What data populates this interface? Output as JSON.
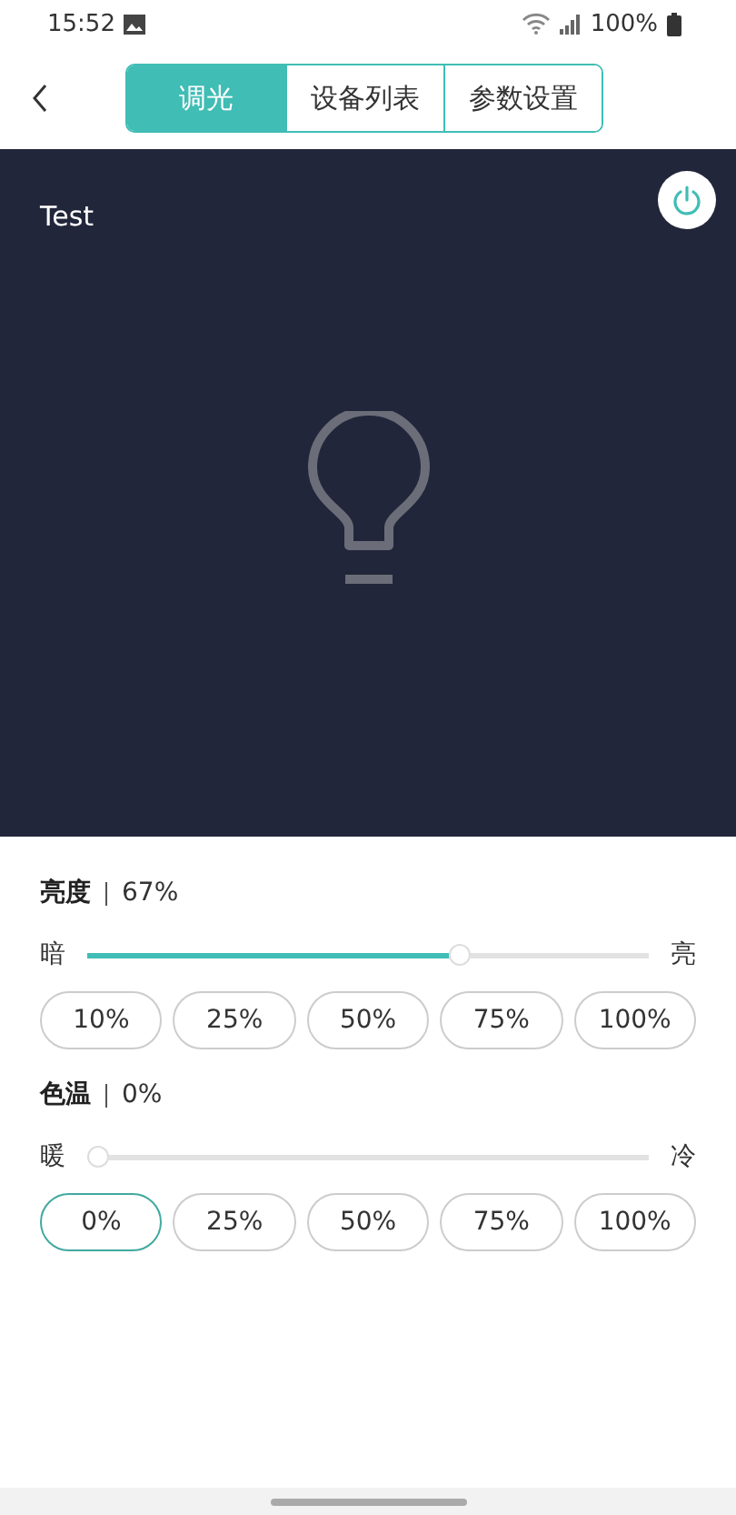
{
  "status_bar": {
    "time": "15:52",
    "battery": "100%"
  },
  "header": {
    "tabs": [
      {
        "label": "调光",
        "selected": true
      },
      {
        "label": "设备列表",
        "selected": false
      },
      {
        "label": "参数设置",
        "selected": false
      }
    ]
  },
  "preview": {
    "title": "Test",
    "power_on": false
  },
  "controls": [
    {
      "title": "亮度",
      "value": "67%",
      "min_label": "暗",
      "max_label": "亮",
      "level": 0.67,
      "presets": [
        {
          "label": "10%",
          "selected": false
        },
        {
          "label": "25%",
          "selected": false
        },
        {
          "label": "50%",
          "selected": false
        },
        {
          "label": "75%",
          "selected": false
        },
        {
          "label": "100%",
          "selected": false
        }
      ]
    },
    {
      "title": "色温",
      "value": "0%",
      "min_label": "暖",
      "max_label": "冷",
      "level": 0,
      "presets": [
        {
          "label": "0%",
          "selected": true
        },
        {
          "label": "25%",
          "selected": false
        },
        {
          "label": "50%",
          "selected": false
        },
        {
          "label": "75%",
          "selected": false
        },
        {
          "label": "100%",
          "selected": false
        }
      ]
    }
  ]
}
